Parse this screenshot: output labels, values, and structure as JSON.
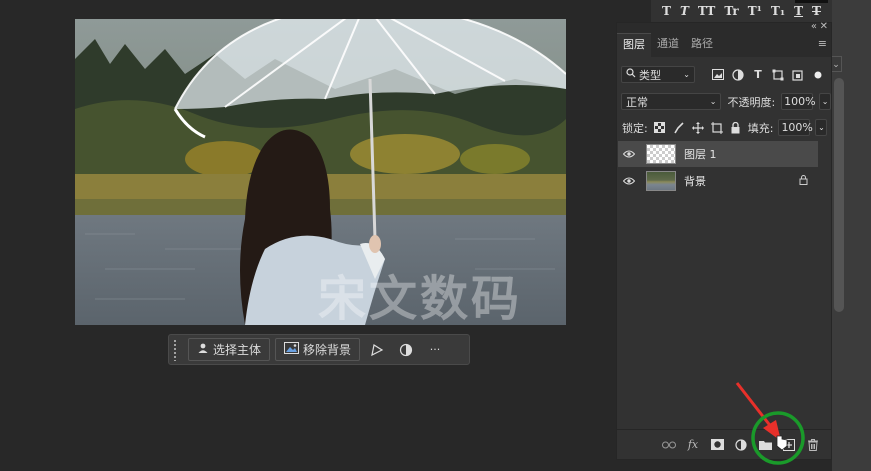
{
  "canvas": {
    "watermark": "宋文数码"
  },
  "taskbar": {
    "select_subject": "选择主体",
    "remove_background": "移除背景",
    "more": "···"
  },
  "character_panel": {
    "glyphs": [
      "T",
      "T",
      "TT",
      "Tr",
      "T¹",
      "T₁",
      "T",
      "T"
    ]
  },
  "layers_panel": {
    "tabs": [
      "图层",
      "通道",
      "路径"
    ],
    "active_tab": "图层",
    "filter_kind": "类型",
    "blend_mode": "正常",
    "opacity_label": "不透明度:",
    "opacity_value": "100%",
    "lock_label": "锁定:",
    "fill_label": "填充:",
    "fill_value": "100%",
    "layers": [
      {
        "name": "图层 1",
        "selected": true,
        "thumbnail": "transparent",
        "locked": false
      },
      {
        "name": "背景",
        "selected": false,
        "thumbnail": "photo",
        "locked": true
      }
    ],
    "bottom_icons": [
      "link-layers-icon",
      "fx-icon",
      "add-mask-icon",
      "adjustment-layer-icon",
      "new-group-icon",
      "new-layer-icon",
      "delete-layer-icon"
    ],
    "fx_label": "fx"
  },
  "annotation": {
    "highlight_color": "#1a9a2a",
    "arrow_color": "#e8302a"
  }
}
